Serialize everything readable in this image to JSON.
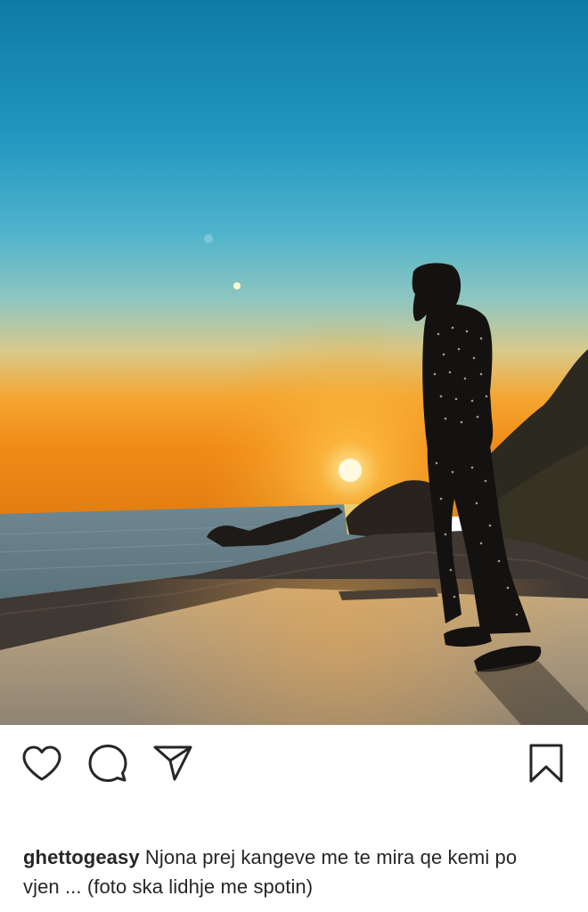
{
  "post": {
    "image": {
      "subject": "man-silhouette-at-sunset-beach"
    },
    "actions": {
      "like_icon": "heart-icon",
      "comment_icon": "comment-icon",
      "share_icon": "send-icon",
      "save_icon": "bookmark-icon"
    },
    "caption": {
      "username": "ghettogeasy",
      "text": "Njona prej kangeve me te mira qe kemi po vjen ... (foto ska lidhje me spotin)"
    }
  }
}
